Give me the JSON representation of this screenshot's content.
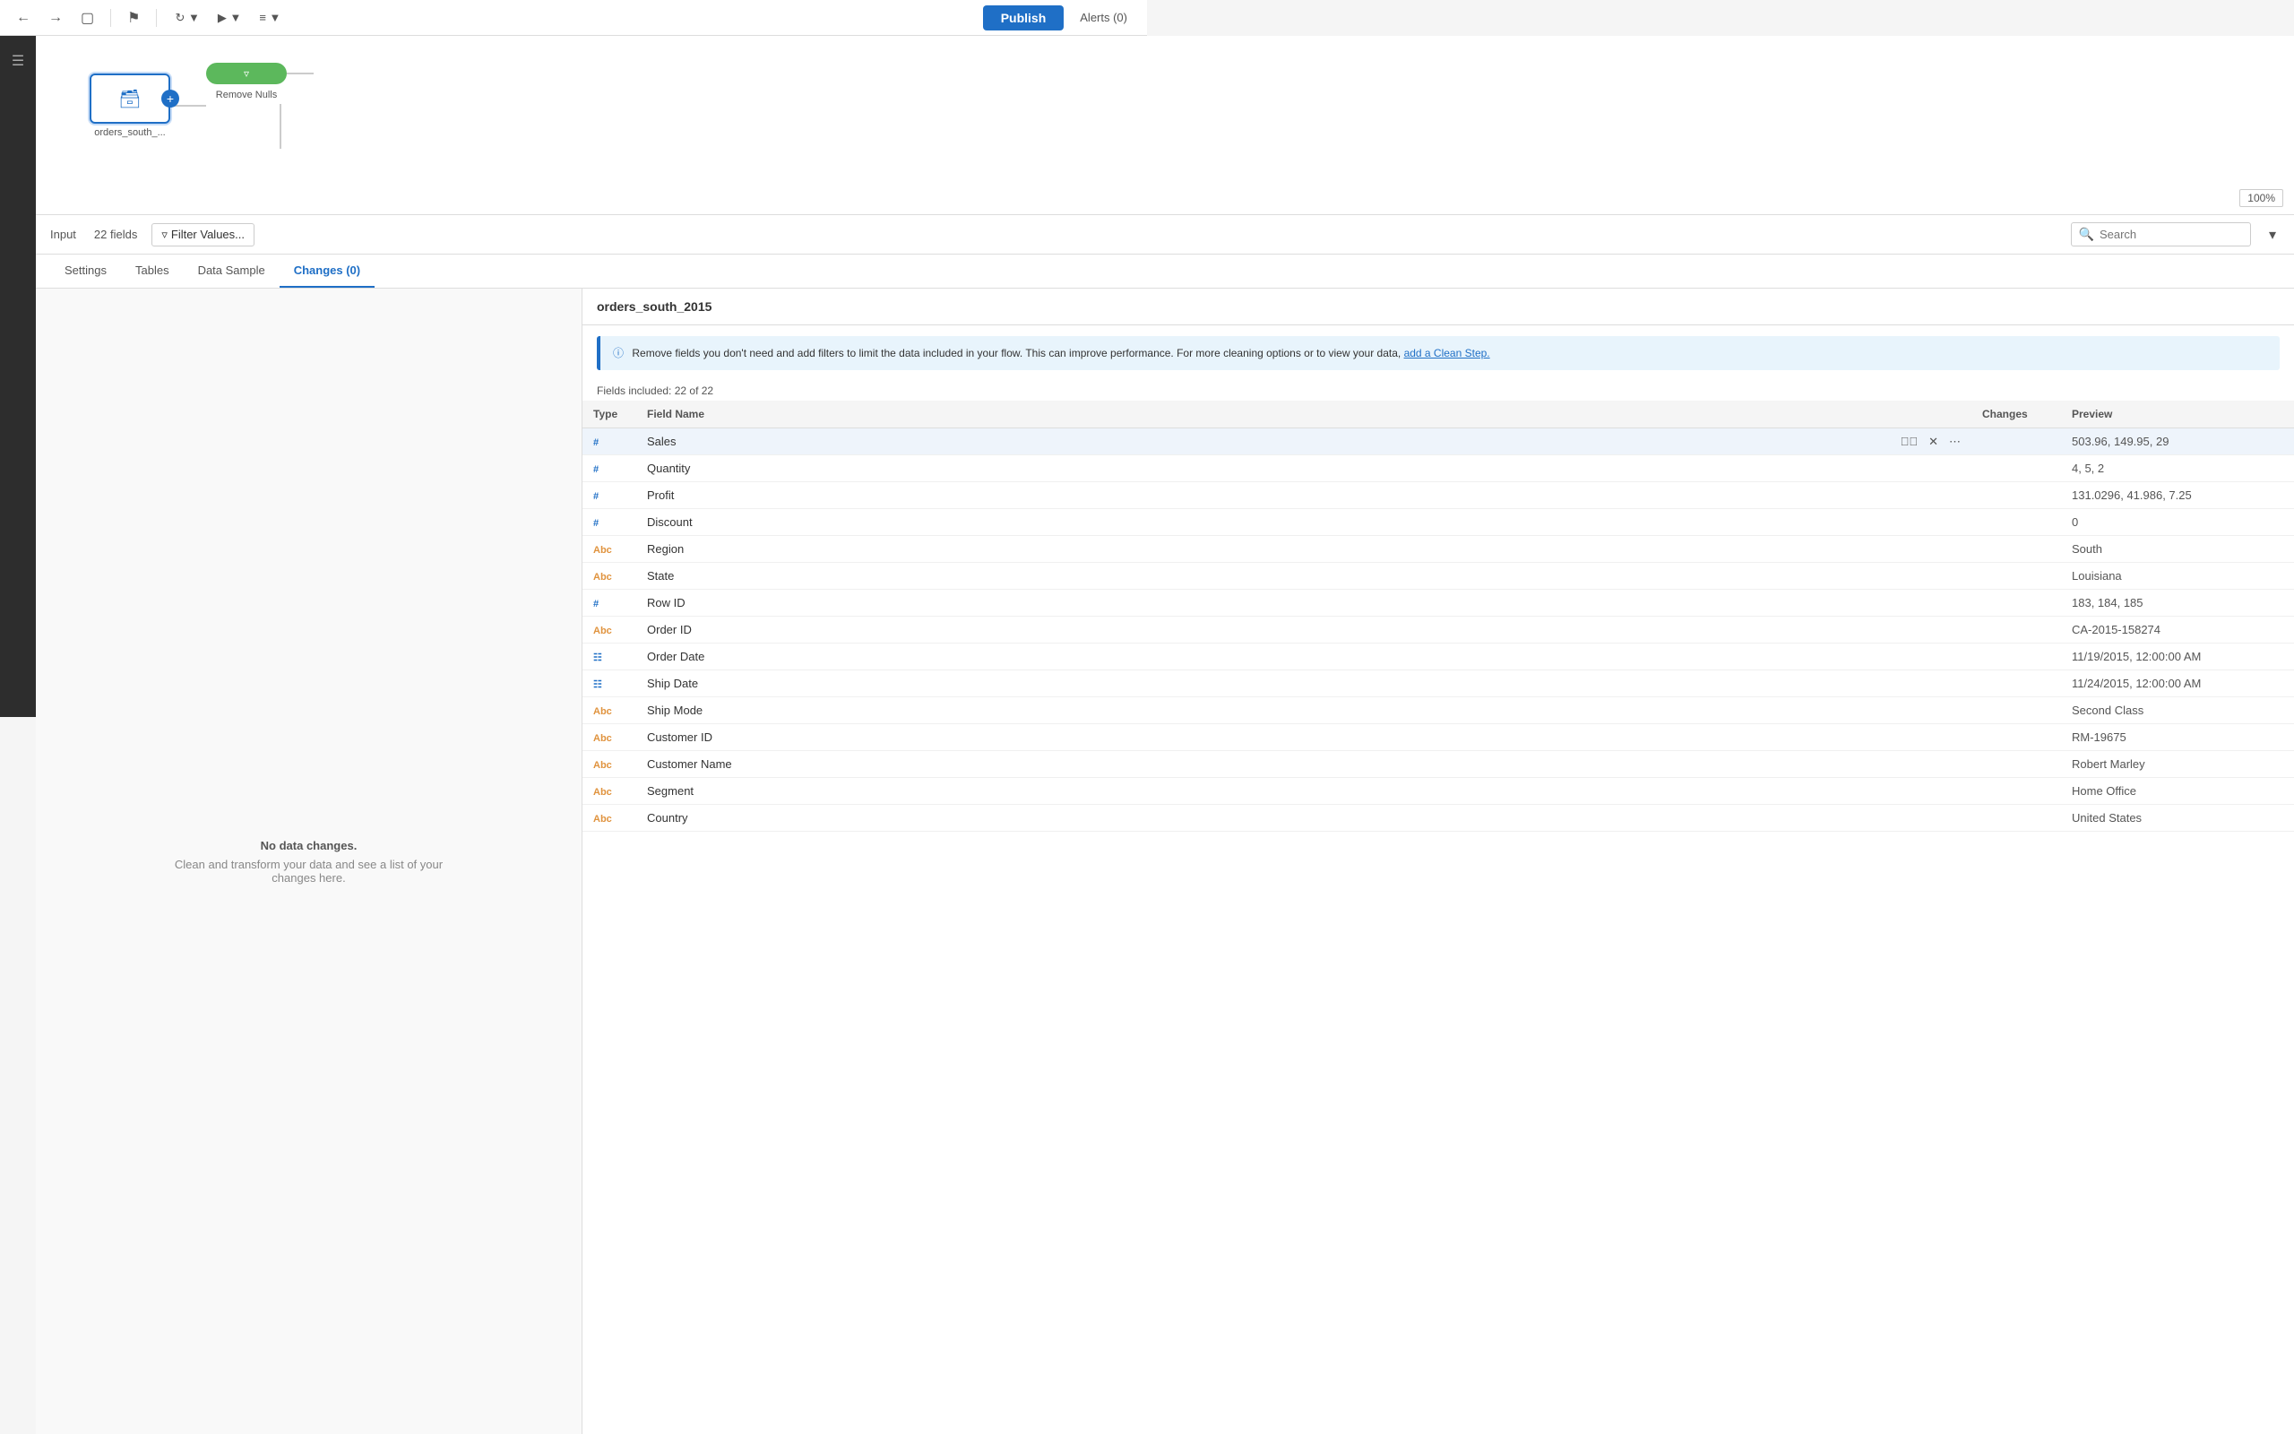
{
  "toolbar": {
    "publish_label": "Publish",
    "alerts_label": "Alerts (0)",
    "zoom_label": "100%"
  },
  "flow": {
    "source_node_label": "orders_south_...",
    "filter_node_label": "Remove Nulls",
    "connector_label": "+"
  },
  "panel": {
    "input_label": "Input",
    "fields_count_label": "22 fields",
    "filter_values_label": "Filter Values...",
    "search_placeholder": "Search",
    "collapse_icon": "▾"
  },
  "tabs": [
    {
      "label": "Settings",
      "active": false
    },
    {
      "label": "Tables",
      "active": false
    },
    {
      "label": "Data Sample",
      "active": false
    },
    {
      "label": "Changes (0)",
      "active": true
    }
  ],
  "left_content": {
    "empty_title": "No data changes.",
    "empty_desc": "Clean and transform your data and see a list of your changes here."
  },
  "right": {
    "title": "orders_south_2015",
    "info_text": "Remove fields you don't need and add filters to limit the data included in your flow. This can improve performance. For more cleaning options or to view your data,",
    "info_link": "add a Clean Step.",
    "fields_included": "Fields included: 22 of 22"
  },
  "table": {
    "columns": [
      "Type",
      "Field Name",
      "Changes",
      "Preview"
    ],
    "rows": [
      {
        "type": "#",
        "name": "Sales",
        "changes": "",
        "preview": "503.96, 149.95, 29",
        "hovered": true
      },
      {
        "type": "#",
        "name": "Quantity",
        "changes": "",
        "preview": "4, 5, 2",
        "hovered": false
      },
      {
        "type": "#",
        "name": "Profit",
        "changes": "",
        "preview": "131.0296, 41.986, 7.25",
        "hovered": false
      },
      {
        "type": "#",
        "name": "Discount",
        "changes": "",
        "preview": "0",
        "hovered": false
      },
      {
        "type": "Abc",
        "name": "Region",
        "changes": "",
        "preview": "South",
        "hovered": false
      },
      {
        "type": "Abc",
        "name": "State",
        "changes": "",
        "preview": "Louisiana",
        "hovered": false
      },
      {
        "type": "#",
        "name": "Row ID",
        "changes": "",
        "preview": "183, 184, 185",
        "hovered": false
      },
      {
        "type": "Abc",
        "name": "Order ID",
        "changes": "",
        "preview": "CA-2015-158274",
        "hovered": false
      },
      {
        "type": "cal",
        "name": "Order Date",
        "changes": "",
        "preview": "11/19/2015, 12:00:00 AM",
        "hovered": false
      },
      {
        "type": "cal",
        "name": "Ship Date",
        "changes": "",
        "preview": "11/24/2015, 12:00:00 AM",
        "hovered": false
      },
      {
        "type": "Abc",
        "name": "Ship Mode",
        "changes": "",
        "preview": "Second Class",
        "hovered": false
      },
      {
        "type": "Abc",
        "name": "Customer ID",
        "changes": "",
        "preview": "RM-19675",
        "hovered": false
      },
      {
        "type": "Abc",
        "name": "Customer Name",
        "changes": "",
        "preview": "Robert Marley",
        "hovered": false
      },
      {
        "type": "Abc",
        "name": "Segment",
        "changes": "",
        "preview": "Home Office",
        "hovered": false
      },
      {
        "type": "Abc",
        "name": "Country",
        "changes": "",
        "preview": "United States",
        "hovered": false
      }
    ]
  }
}
